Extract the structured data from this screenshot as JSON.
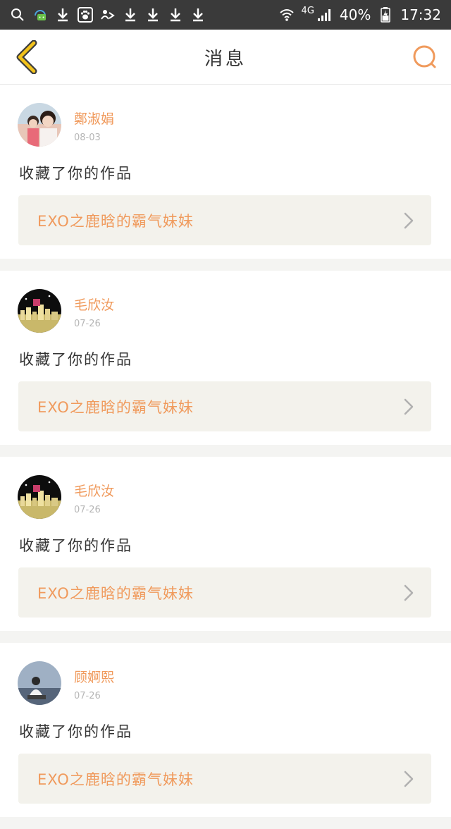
{
  "status_bar": {
    "network": "4G",
    "battery": "40%",
    "time": "17:32"
  },
  "header": {
    "title": "消息"
  },
  "messages": [
    {
      "sender": "鄭淑娟",
      "date": "08-03",
      "action": "收藏了你的作品",
      "work_title": "EXO之鹿晗的霸气妹妹"
    },
    {
      "sender": "毛欣汝",
      "date": "07-26",
      "action": "收藏了你的作品",
      "work_title": "EXO之鹿晗的霸气妹妹"
    },
    {
      "sender": "毛欣汝",
      "date": "07-26",
      "action": "收藏了你的作品",
      "work_title": "EXO之鹿晗的霸气妹妹"
    },
    {
      "sender": "顾婀熙",
      "date": "07-26",
      "action": "收藏了你的作品",
      "work_title": "EXO之鹿晗的霸气妹妹"
    }
  ],
  "colors": {
    "accent": "#f09a5c",
    "back_arrow": "#f2c21b",
    "card_link_bg": "#f3f2ec",
    "status_bar_bg": "#3a3a3a"
  }
}
